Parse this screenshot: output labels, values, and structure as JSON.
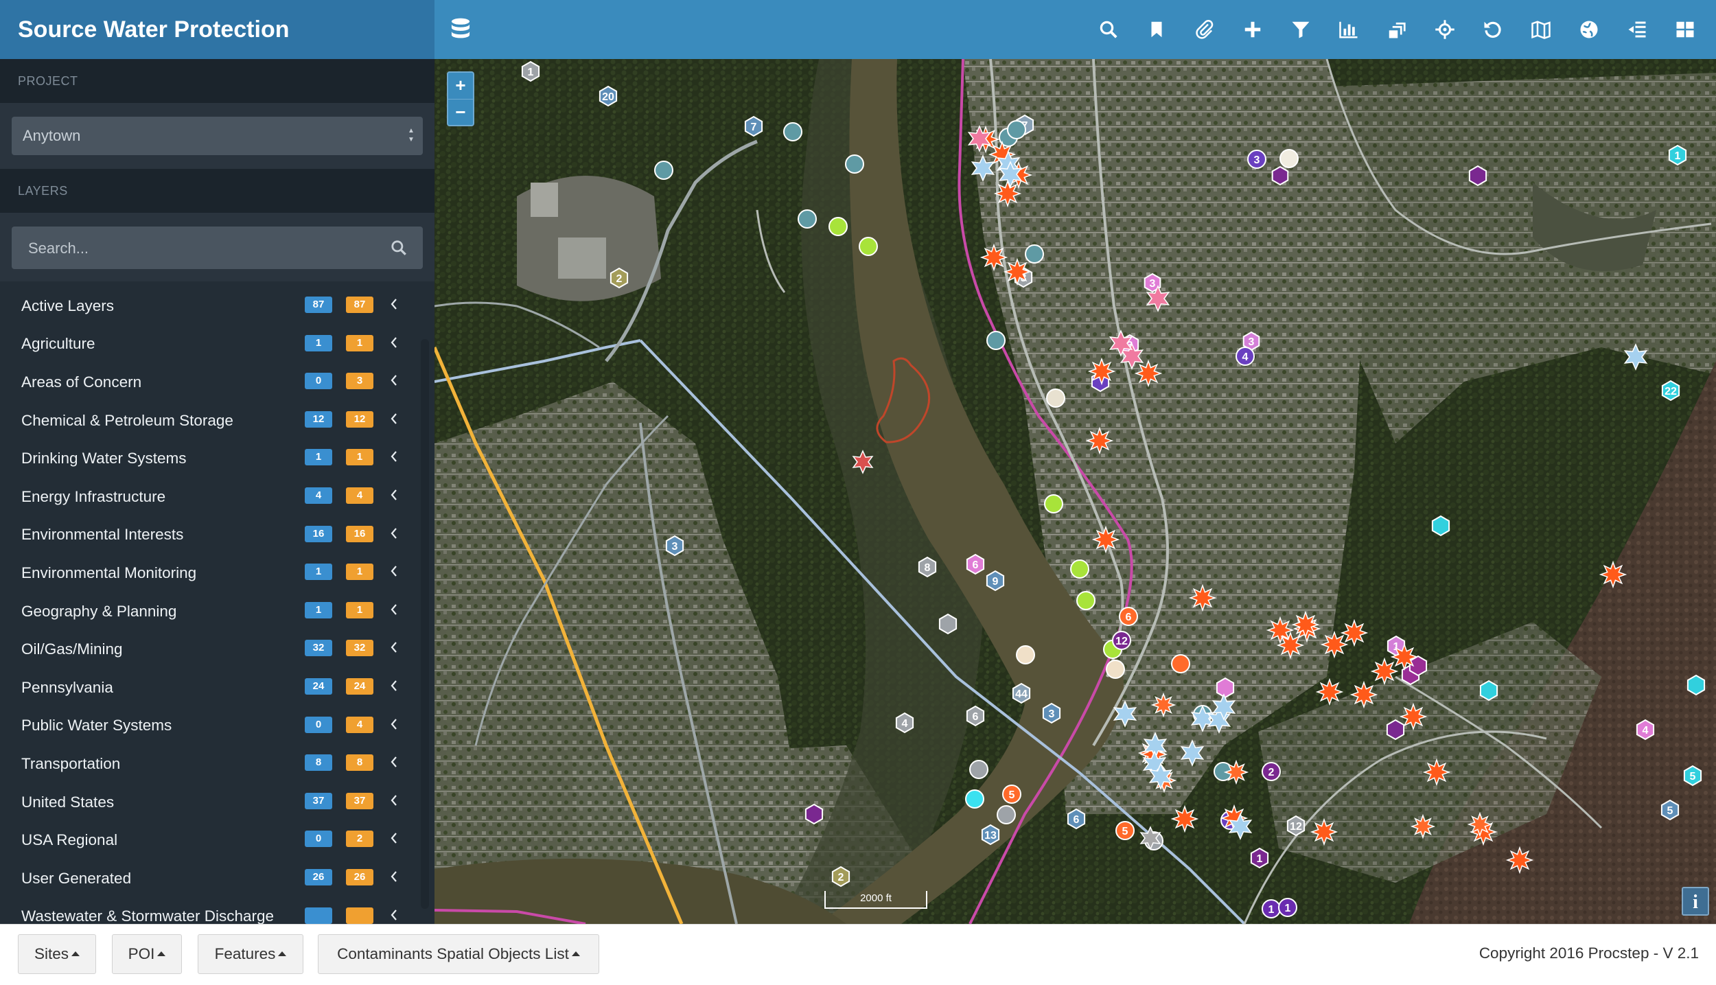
{
  "app": {
    "title": "Source Water Protection"
  },
  "toolbar": {
    "tools": [
      "search-icon",
      "bookmark-icon",
      "paperclip-icon",
      "plus-icon",
      "filter-icon",
      "bar-chart-icon",
      "layers-stack-icon",
      "crosshair-icon",
      "undo-icon",
      "map-icon",
      "globe-icon",
      "indent-icon",
      "grid-icon"
    ]
  },
  "sidebar": {
    "project_heading": "PROJECT",
    "project_value": "Anytown",
    "layers_heading": "LAYERS",
    "search_placeholder": "Search...",
    "layers": [
      {
        "name": "Active Layers",
        "active": "87",
        "total": "87"
      },
      {
        "name": "Agriculture",
        "active": "1",
        "total": "1"
      },
      {
        "name": "Areas of Concern",
        "active": "0",
        "total": "3"
      },
      {
        "name": "Chemical & Petroleum Storage",
        "active": "12",
        "total": "12"
      },
      {
        "name": "Drinking Water Systems",
        "active": "1",
        "total": "1"
      },
      {
        "name": "Energy Infrastructure",
        "active": "4",
        "total": "4"
      },
      {
        "name": "Environmental Interests",
        "active": "16",
        "total": "16"
      },
      {
        "name": "Environmental Monitoring",
        "active": "1",
        "total": "1"
      },
      {
        "name": "Geography & Planning",
        "active": "1",
        "total": "1"
      },
      {
        "name": "Oil/Gas/Mining",
        "active": "32",
        "total": "32"
      },
      {
        "name": "Pennsylvania",
        "active": "24",
        "total": "24"
      },
      {
        "name": "Public Water Systems",
        "active": "0",
        "total": "4"
      },
      {
        "name": "Transportation",
        "active": "8",
        "total": "8"
      },
      {
        "name": "United States",
        "active": "37",
        "total": "37"
      },
      {
        "name": "USA Regional",
        "active": "0",
        "total": "2"
      },
      {
        "name": "User Generated",
        "active": "26",
        "total": "26"
      },
      {
        "name": "Wastewater & Stormwater Discharge",
        "active": "",
        "total": ""
      }
    ]
  },
  "map": {
    "zoom_in": "+",
    "zoom_out": "−",
    "scale_label": "2000 ft",
    "info_label": "i",
    "markers": {
      "hex_numbers": [
        "1",
        "20",
        "7",
        "7",
        "2",
        "3",
        "8",
        "3",
        "6",
        "9",
        "44",
        "3",
        "4",
        "6",
        "5",
        "3",
        "6",
        "1",
        "12",
        "5",
        "1",
        "25",
        "22",
        "4",
        "3",
        "2",
        "13",
        "7",
        "2",
        "1",
        "7",
        "1",
        "4",
        "2"
      ],
      "circle_numbers": []
    }
  },
  "footer": {
    "buttons": [
      "Sites",
      "POI",
      "Features",
      "Contaminants Spatial Objects List"
    ],
    "copyright": "Copyright 2016 Procstep - V 2.1"
  }
}
